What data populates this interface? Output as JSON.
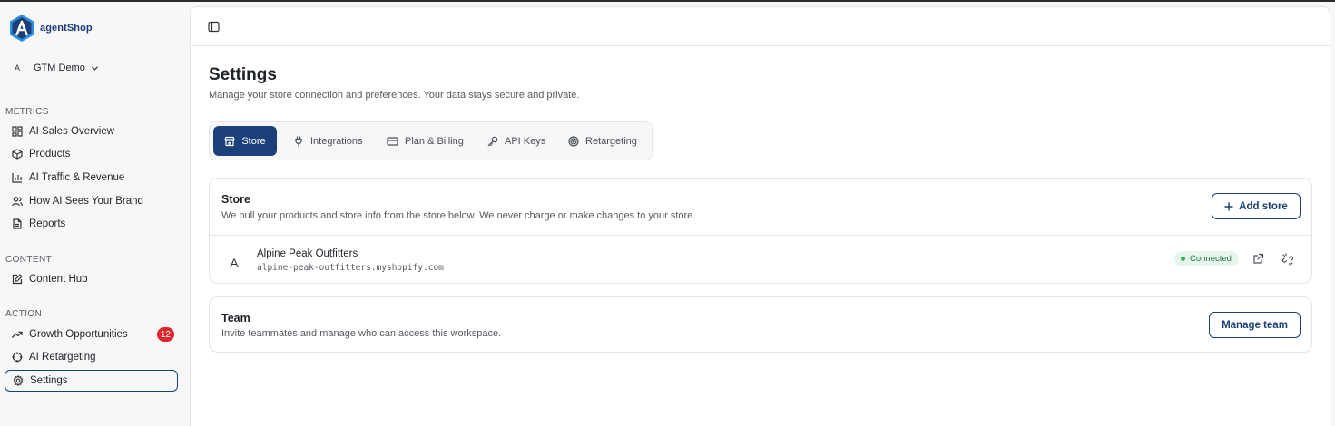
{
  "brand": {
    "name": "agentShop",
    "logo_letter": "A",
    "accent": "#1b3f78"
  },
  "workspace": {
    "avatar": "A",
    "name": "GTM Demo"
  },
  "sidebar": {
    "sections": [
      {
        "label": "METRICS",
        "items": [
          {
            "label": "AI Sales Overview",
            "icon": "dashboard-grid-icon"
          },
          {
            "label": "Products",
            "icon": "box-icon"
          },
          {
            "label": "AI Traffic & Revenue",
            "icon": "bar-chart-icon"
          },
          {
            "label": "How AI Sees Your Brand",
            "icon": "users-icon"
          },
          {
            "label": "Reports",
            "icon": "file-icon"
          }
        ]
      },
      {
        "label": "CONTENT",
        "items": [
          {
            "label": "Content Hub",
            "icon": "edit-icon"
          }
        ]
      },
      {
        "label": "ACTION",
        "items": [
          {
            "label": "Growth Opportunities",
            "icon": "trending-up-icon",
            "badge": "12"
          },
          {
            "label": "AI Retargeting",
            "icon": "crosshair-icon"
          },
          {
            "label": "Settings",
            "icon": "gear-icon",
            "active": true
          }
        ]
      }
    ]
  },
  "page": {
    "title": "Settings",
    "subtitle": "Manage your store connection and preferences. Your data stays secure and private."
  },
  "tabs": [
    {
      "label": "Store",
      "icon": "store-icon",
      "active": true
    },
    {
      "label": "Integrations",
      "icon": "plug-icon"
    },
    {
      "label": "Plan & Billing",
      "icon": "credit-card-icon"
    },
    {
      "label": "API Keys",
      "icon": "key-icon"
    },
    {
      "label": "Retargeting",
      "icon": "target-icon"
    }
  ],
  "store_card": {
    "title": "Store",
    "description": "We pull your products and store info from the store below. We never charge or make changes to your store.",
    "add_button": "Add store",
    "store": {
      "avatar": "A",
      "name": "Alpine Peak Outfitters",
      "domain": "alpine-peak-outfitters.myshopify.com",
      "status": "Connected",
      "status_color": "#2fb15c"
    }
  },
  "team_card": {
    "title": "Team",
    "description": "Invite teammates and manage who can access this workspace.",
    "button": "Manage team"
  }
}
